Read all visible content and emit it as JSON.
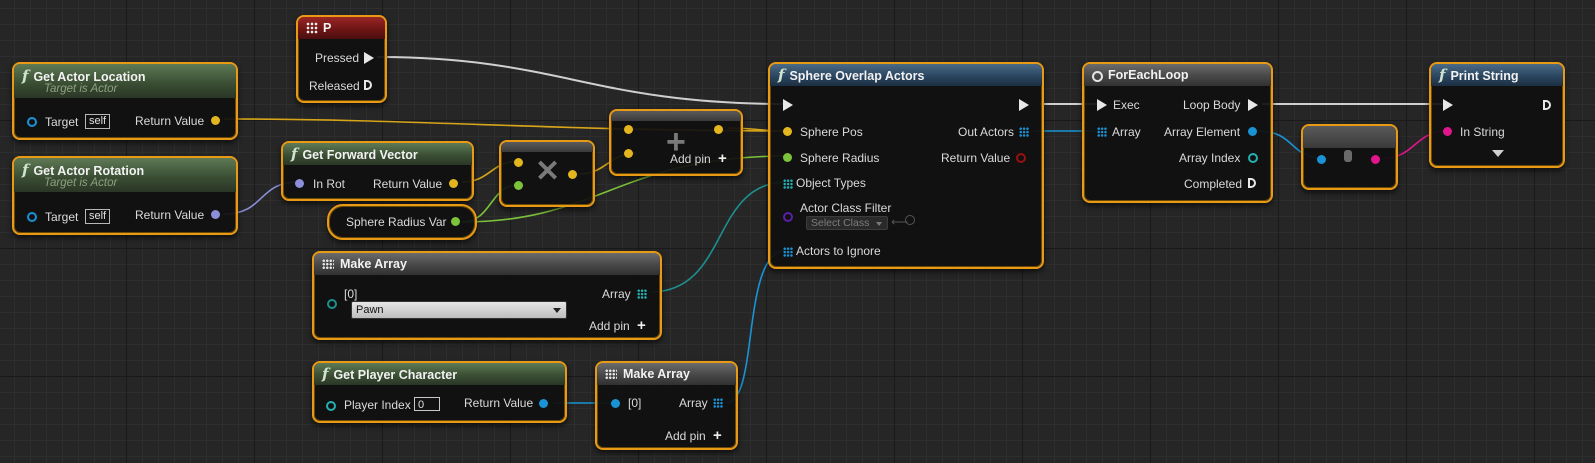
{
  "colors": {
    "exec": "#e8e8e8",
    "vector": "#e3b51e",
    "rotator": "#8b8ed8",
    "float": "#7cc33b",
    "object": "#1a93d6",
    "class": "#5a1fa8",
    "string": "#e2168c",
    "enum_array": "#22b0b0",
    "node_border": "#e89a15"
  },
  "nodes": {
    "p_key": {
      "title": "P",
      "icon": "keyboard-icon",
      "pressed": "Pressed",
      "released": "Released"
    },
    "get_actor_location": {
      "title": "Get Actor Location",
      "subtitle": "Target is Actor",
      "target": "Target",
      "self": "self",
      "ret": "Return Value"
    },
    "get_actor_rotation": {
      "title": "Get Actor Rotation",
      "subtitle": "Target is Actor",
      "target": "Target",
      "self": "self",
      "ret": "Return Value"
    },
    "get_forward_vector": {
      "title": "Get Forward Vector",
      "in_rot": "In Rot",
      "ret": "Return Value"
    },
    "sphere_radius_var": {
      "label": "Sphere Radius Var"
    },
    "multiply": {
      "icon": "multiply-icon",
      "symbol": "✕"
    },
    "add": {
      "icon": "plus-icon",
      "symbol": "+",
      "add_pin": "Add pin"
    },
    "sphere_overlap": {
      "title": "Sphere Overlap Actors",
      "sphere_pos": "Sphere Pos",
      "sphere_radius": "Sphere Radius",
      "object_types": "Object Types",
      "actor_class_filter": "Actor Class Filter",
      "select_class": "Select Class",
      "actors_to_ignore": "Actors to Ignore",
      "out_actors": "Out Actors",
      "ret": "Return Value"
    },
    "make_array_1": {
      "title": "Make Array",
      "index": "[0]",
      "value": "Pawn",
      "array": "Array",
      "add_pin": "Add pin"
    },
    "get_player_character": {
      "title": "Get Player Character",
      "player_index": "Player Index",
      "index_value": "0",
      "ret": "Return Value"
    },
    "make_array_2": {
      "title": "Make Array",
      "index": "[0]",
      "array": "Array",
      "add_pin": "Add pin"
    },
    "for_each_loop": {
      "title": "ForEachLoop",
      "exec": "Exec",
      "array": "Array",
      "loop_body": "Loop Body",
      "array_element": "Array Element",
      "array_index": "Array Index",
      "completed": "Completed"
    },
    "cast": {
      "icon": "conversion-icon"
    },
    "print_string": {
      "title": "Print String",
      "in_string": "In String"
    }
  }
}
